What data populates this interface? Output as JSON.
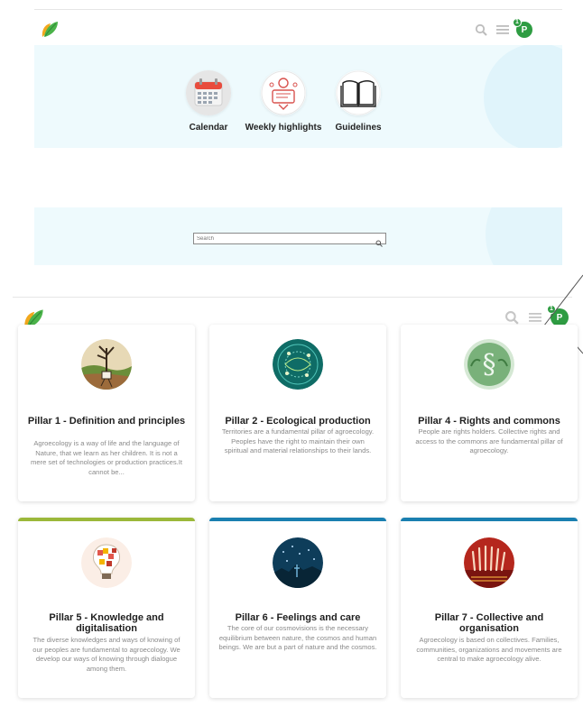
{
  "header": {
    "avatar_initial": "P",
    "notification_count": "1",
    "brand_color": "#2e9c42"
  },
  "shortcuts": [
    {
      "label": "Calendar",
      "icon": "calendar-icon"
    },
    {
      "label": "Weekly highlights",
      "icon": "highlights-icon"
    },
    {
      "label": "Guidelines",
      "icon": "book-icon"
    }
  ],
  "search": {
    "placeholder": "Search",
    "value": ""
  },
  "header2": {
    "avatar_initial": "P",
    "notification_count": "1"
  },
  "pillars": [
    {
      "title": "Pillar 1 - Definition and principles",
      "desc": "Agroecology is a way of life and the language of Nature, that we learn as her children. It is not a mere set of technologies or production practices.It cannot be...",
      "accent": "#ffffff"
    },
    {
      "title": "Pillar 2 - Ecological production",
      "desc": "Territories are a fundamental pillar of agroecology. Peoples have the right to maintain their own spiritual and material relationships to their lands.",
      "accent": "#ffffff"
    },
    {
      "title": "Pillar 4 - Rights and commons",
      "desc": "People are rights holders. Collective rights and access to the commons are fundamental pillar of agroecology.",
      "accent": "#ffffff"
    },
    {
      "title": "Pillar 5 - Knowledge and digitalisation",
      "desc": "The diverse knowledges and ways of knowing of our peoples are fundamental to agroecology. We develop our ways of knowing through dialogue among them.",
      "accent": "#9bb83a"
    },
    {
      "title": "Pillar 6 - Feelings and care",
      "desc": "The core of our cosmovisions is the necessary equilibrium between nature, the cosmos and human beings. We are but a part of nature and the cosmos.",
      "accent": "#1a7fb0"
    },
    {
      "title": "Pillar 7 - Collective and organisation",
      "desc": "Agroecology is based on collectives. Families, communities, organizations and movements are central to make agroecology alive.",
      "accent": "#1a7fb0"
    }
  ]
}
